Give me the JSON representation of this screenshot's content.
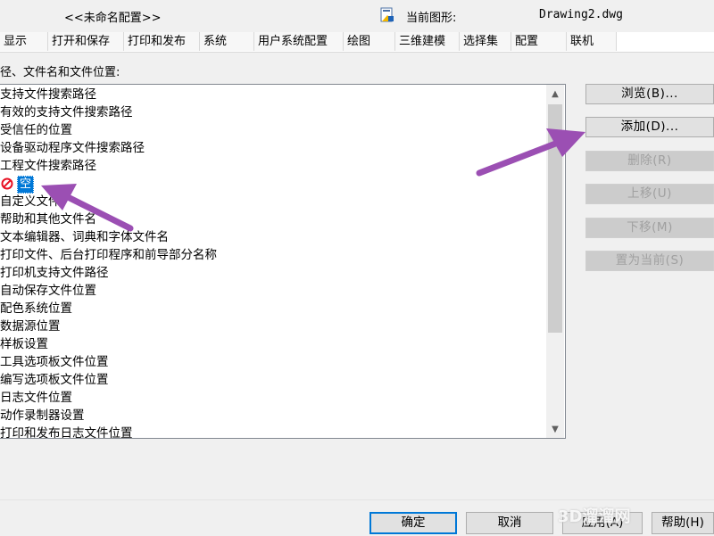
{
  "header": {
    "profile": "<<未命名配置>>",
    "current_drawing_label": "当前图形:",
    "current_drawing_value": "Drawing2.dwg"
  },
  "tabs": [
    "显示",
    "打开和保存",
    "打印和发布",
    "系统",
    "用户系统配置",
    "绘图",
    "三维建模",
    "选择集",
    "配置",
    "联机"
  ],
  "section_label": "径、文件名和文件位置:",
  "list": {
    "items": [
      "支持文件搜索路径",
      "有效的支持文件搜索路径",
      "受信任的位置",
      "设备驱动程序文件搜索路径",
      "工程文件搜索路径",
      "自定义文件",
      "帮助和其他文件名",
      "文本编辑器、词典和字体文件名",
      "打印文件、后台打印程序和前导部分名称",
      "打印机支持文件路径",
      "自动保存文件位置",
      "配色系统位置",
      "数据源位置",
      "样板设置",
      "工具选项板文件位置",
      "编写选项板文件位置",
      "日志文件位置",
      "动作录制器设置",
      "打印和发布日志文件位置"
    ],
    "empty_tag": "空",
    "scroll_up": "▲",
    "scroll_down": "▼"
  },
  "side_buttons": {
    "browse": "浏览(B)...",
    "add": "添加(D)...",
    "delete": "删除(R)",
    "move_up": "上移(U)",
    "move_down": "下移(M)",
    "set_current": "置为当前(S)"
  },
  "bottom_buttons": {
    "ok": "确定",
    "cancel": "取消",
    "apply": "应用(A)",
    "help": "帮助(H)"
  },
  "watermark": "3D溜溜网",
  "colors": {
    "selection": "#0078d7",
    "annotation_arrow": "#9b4fb3"
  }
}
